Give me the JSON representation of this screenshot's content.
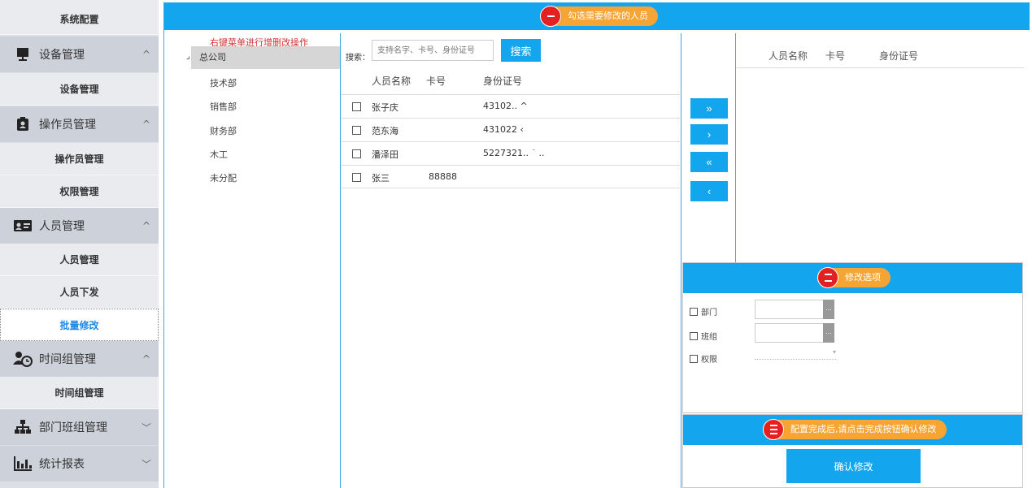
{
  "sidebar": {
    "items": [
      {
        "type": "sub",
        "label": "系统配置"
      },
      {
        "type": "group",
        "label": "设备管理",
        "icon": "monitor-icon",
        "chevron": "^"
      },
      {
        "type": "sub",
        "label": "设备管理"
      },
      {
        "type": "group",
        "label": "操作员管理",
        "icon": "id-badge-icon",
        "chevron": "^"
      },
      {
        "type": "sub",
        "label": "操作员管理"
      },
      {
        "type": "sub",
        "label": "权限管理"
      },
      {
        "type": "group",
        "label": "人员管理",
        "icon": "id-card-icon",
        "chevron": "^"
      },
      {
        "type": "sub",
        "label": "人员管理"
      },
      {
        "type": "sub",
        "label": "人员下发"
      },
      {
        "type": "sub",
        "label": "批量修改",
        "active": true
      },
      {
        "type": "group",
        "label": "时间组管理",
        "icon": "user-clock-icon",
        "chevron": "^"
      },
      {
        "type": "sub",
        "label": "时间组管理"
      },
      {
        "type": "group",
        "label": "部门班组管理",
        "icon": "org-chart-icon",
        "chevron": "﹀"
      },
      {
        "type": "group",
        "label": "统计报表",
        "icon": "report-chart-icon",
        "chevron": "﹀"
      }
    ]
  },
  "step1": {
    "label": "勾选需要修改的人员"
  },
  "tree": {
    "hint": "右键菜单进行增删改操作",
    "toggle": "⌟",
    "root": "总公司",
    "children": [
      "技术部",
      "销售部",
      "财务部",
      "木工",
      "未分配"
    ]
  },
  "search": {
    "label": "搜索：",
    "placeholder": "支持名字、卡号、身份证号",
    "button": "搜索"
  },
  "list": {
    "headers": [
      "人员名称",
      "卡号",
      "身份证号"
    ],
    "rows": [
      {
        "name": "张子庆",
        "card": "",
        "id": "43102..  ^"
      },
      {
        "name": "范东海",
        "card": "",
        "id": "431022  ‹"
      },
      {
        "name": "潘泽田",
        "card": "",
        "id": "5227321..  ˙  .."
      },
      {
        "name": "张三",
        "card": "88888",
        "id": ""
      }
    ]
  },
  "transfer": {
    "all_right": "»",
    "right": "›",
    "all_left": "«",
    "left": "‹"
  },
  "selected": {
    "headers": [
      "人员名称",
      "卡号",
      "身份证号"
    ]
  },
  "step2": {
    "label": "修改选项"
  },
  "options": {
    "dept_label": "部门",
    "team_label": "班组",
    "perm_label": "权限",
    "btn_glyph": "...",
    "dd_glyph": "▾"
  },
  "step3": {
    "label": "配置完成后,请点击完成按钮确认修改"
  },
  "confirm": {
    "button": "确认修改"
  },
  "colors": {
    "accent": "#13a6ee",
    "pill": "#f6a534",
    "badge": "#e42120",
    "active_text": "#1e88e5"
  }
}
